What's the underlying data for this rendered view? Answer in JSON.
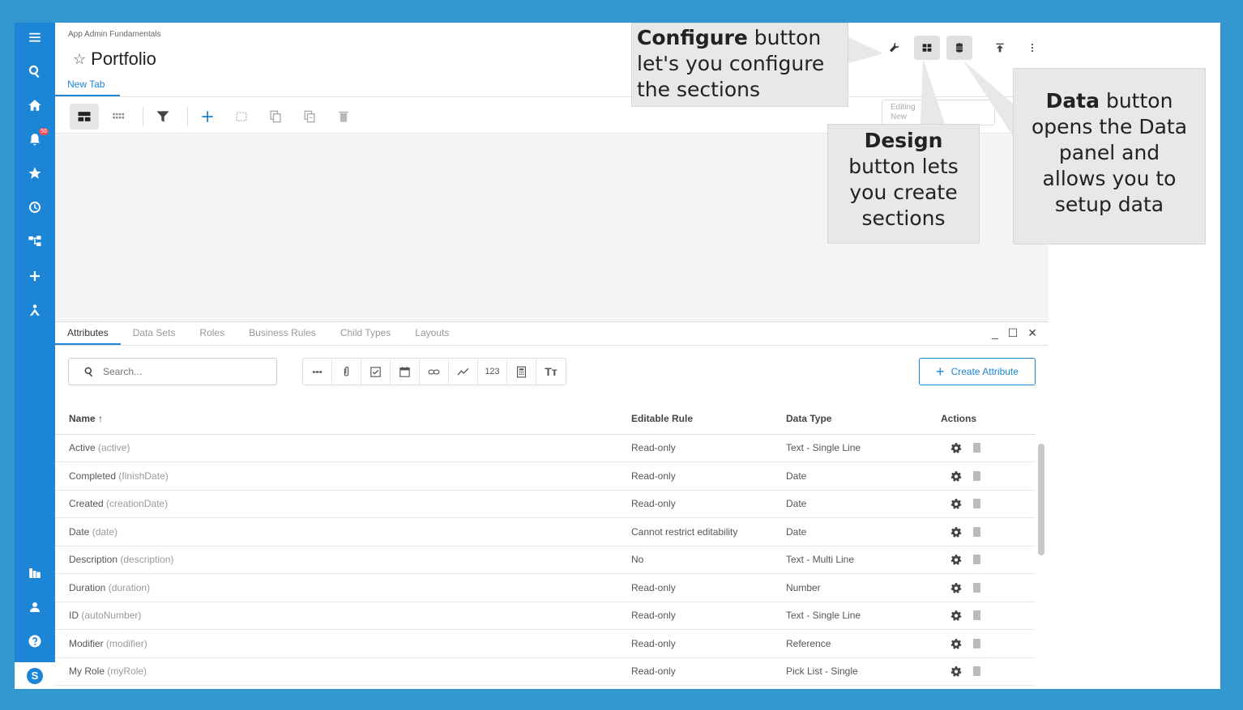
{
  "colors": {
    "accent": "#1d85d6",
    "nav_bg": "#1d85d6",
    "outer_bg": "#3497cf",
    "callout_bg": "#e7e8ea"
  },
  "nav": {
    "items": [
      {
        "icon": "menu-icon"
      },
      {
        "icon": "search-icon"
      },
      {
        "icon": "home-icon"
      },
      {
        "icon": "notifications-icon",
        "badge": "55"
      },
      {
        "icon": "star-icon"
      },
      {
        "icon": "history-icon"
      },
      {
        "icon": "hierarchy-icon"
      },
      {
        "icon": "plus-icon"
      },
      {
        "icon": "admin-icon"
      },
      {
        "icon": "library-icon"
      },
      {
        "icon": "user-icon"
      },
      {
        "icon": "help-icon"
      }
    ],
    "logo_letter": "S"
  },
  "header": {
    "breadcrumb": "App Admin Fundamentals",
    "title": "Portfolio",
    "tab": "New Tab",
    "editing_label": "Editing",
    "editing_value": "New"
  },
  "panel": {
    "tabs": [
      "Attributes",
      "Data Sets",
      "Roles",
      "Business Rules",
      "Child Types",
      "Layouts"
    ],
    "search_placeholder": "Search...",
    "create_button": "Create Attribute",
    "filter_number_label": "123",
    "filter_text_label": "Tт",
    "columns": {
      "name": "Name",
      "rule": "Editable Rule",
      "type": "Data Type",
      "actions": "Actions"
    },
    "rows": [
      {
        "name": "Active",
        "key": "(active)",
        "rule": "Read-only",
        "type": "Text - Single Line"
      },
      {
        "name": "Completed",
        "key": "(finishDate)",
        "rule": "Read-only",
        "type": "Date"
      },
      {
        "name": "Created",
        "key": "(creationDate)",
        "rule": "Read-only",
        "type": "Date"
      },
      {
        "name": "Date",
        "key": "(date)",
        "rule": "Cannot restrict editability",
        "type": "Date"
      },
      {
        "name": "Description",
        "key": "(description)",
        "rule": "No",
        "type": "Text - Multi Line"
      },
      {
        "name": "Duration",
        "key": "(duration)",
        "rule": "Read-only",
        "type": "Number"
      },
      {
        "name": "ID",
        "key": "(autoNumber)",
        "rule": "Read-only",
        "type": "Text - Single Line"
      },
      {
        "name": "Modifier",
        "key": "(modifier)",
        "rule": "Read-only",
        "type": "Reference"
      },
      {
        "name": "My Role",
        "key": "(myRole)",
        "rule": "Read-only",
        "type": "Pick List - Single"
      }
    ]
  },
  "callouts": {
    "configure": {
      "bold": "Configure",
      "text1": " button",
      "text2": "let's you configure",
      "text3": "the sections"
    },
    "design": {
      "bold": "Design",
      "text1": "button lets",
      "text2": "you create",
      "text3": "sections"
    },
    "data": {
      "bold": "Data",
      "text1": " button",
      "text2": "opens the Data",
      "text3": "panel and",
      "text4": "allows you to",
      "text5": "setup data"
    }
  }
}
